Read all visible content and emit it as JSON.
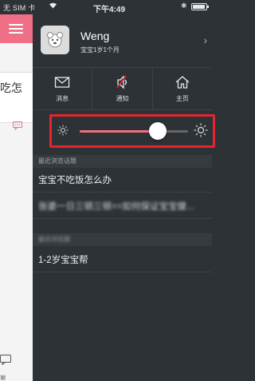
{
  "status_bar": {
    "carrier": "无 SIM 卡",
    "wifi_icon": "wifi-icon",
    "time": "下午4:49",
    "bluetooth_icon": "bluetooth-icon",
    "battery_level": 0.85
  },
  "background_app": {
    "menu_icon": "menu-icon",
    "card_text": "吃怎",
    "chat_icon": "chat-bubble-icon",
    "bottom_label": "谢",
    "accent_color": "#ee6f86"
  },
  "profile": {
    "name": "Weng",
    "subtitle": "宝宝1岁1个月",
    "chevron": "›"
  },
  "quick_actions": [
    {
      "label": "消息",
      "icon": "envelope-icon"
    },
    {
      "label": "通知",
      "icon": "speaker-muted-icon"
    },
    {
      "label": "主页",
      "icon": "home-icon"
    }
  ],
  "brightness": {
    "value_fraction": 0.72,
    "track_color": "#f16e82",
    "highlight_color": "#e8252d"
  },
  "recent_topics": {
    "header": "最近浏览话题",
    "items": [
      "宝宝不吃饭怎么办",
      "张婆一日三顿三顿==如何保证宝宝健..."
    ]
  },
  "recent_groups": {
    "header": "最近浏览圈",
    "items": [
      "1-2岁宝宝帮"
    ]
  }
}
